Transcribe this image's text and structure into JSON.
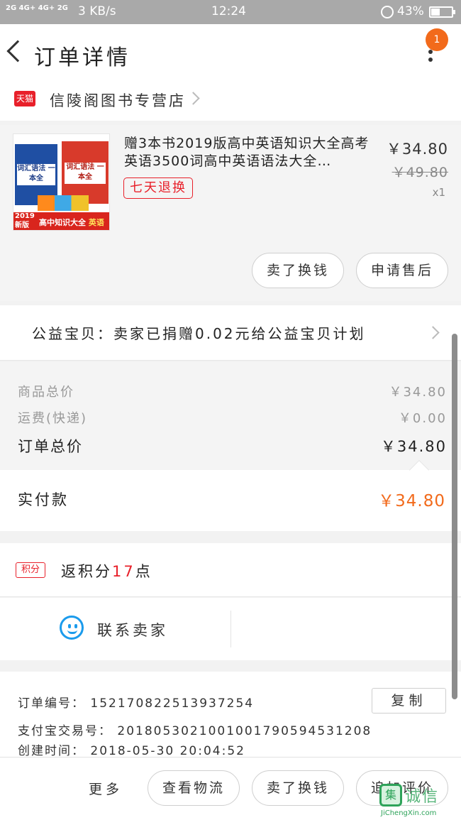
{
  "status_bar": {
    "signal_text": "2G 4G+ 4G+ 2G",
    "speed": "3 KB/s",
    "time": "12:24",
    "battery": "43%"
  },
  "header": {
    "title": "订单详情",
    "badge_count": "1"
  },
  "shop": {
    "tmall_label": "天猫",
    "name": "信陵阁图书专营店"
  },
  "product": {
    "title": "赠3本书2019版高中英语知识大全高考英语3500词高中英语语法大全…",
    "tag": "七天退换",
    "price": "￥34.80",
    "original_price": "￥49.80",
    "quantity": "x1",
    "thumb": {
      "book1_label": "词汇语法 一本全",
      "book2_label": "词汇语法 一本全",
      "banner_year": "2019",
      "banner_edition": "新版",
      "banner_text": "高中知识大全",
      "banner_subject": "英语"
    },
    "buttons": {
      "return": "卖了换钱",
      "after_sale": "申请售后"
    }
  },
  "charity": {
    "text": "公益宝贝：卖家已捐赠0.02元给公益宝贝计划"
  },
  "summary": {
    "goods_label": "商品总价",
    "goods_value": "￥34.80",
    "shipping_label": "运费(快递)",
    "shipping_value": "￥0.00",
    "order_total_label": "订单总价",
    "order_total_value": "￥34.80"
  },
  "payment": {
    "label": "实付款",
    "amount": "￥34.80"
  },
  "points": {
    "badge": "积分",
    "text_before": "返积分",
    "number": "17",
    "text_after": "点"
  },
  "contact": {
    "label": "联系卖家"
  },
  "order_info": {
    "order_no": "订单编号：  1521708225139372​54",
    "alipay_no": "支付宝交易号：  2018053021001001790594531208",
    "created": "创建时间：  2018-05-30 20:04:52",
    "copy_button": "复制"
  },
  "bottom_bar": {
    "more": "更多",
    "logistics": "查看物流",
    "resell": "卖了换钱",
    "review": "追加评价"
  },
  "watermark": {
    "logo": "集",
    "cn": "诚信",
    "en": "JiChengXin.com"
  },
  "colors": {
    "accent": "#f26a1b",
    "tmall_red": "#e8202a",
    "chat_blue": "#1b9bec"
  }
}
